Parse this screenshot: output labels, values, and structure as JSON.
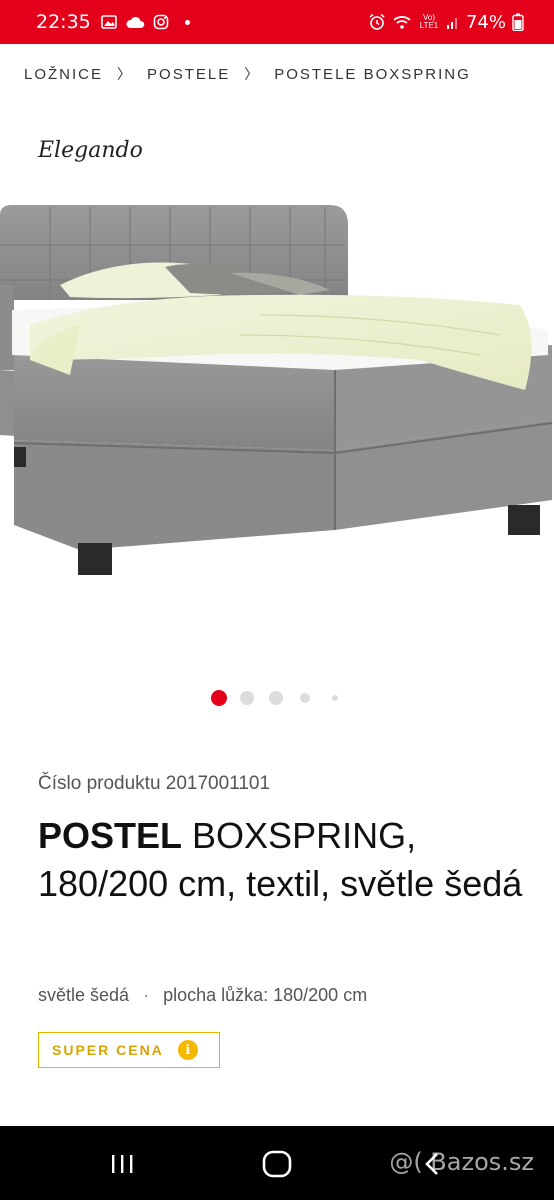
{
  "status_bar": {
    "time": "22:35",
    "battery": "74%",
    "network": "Vo) LTE1",
    "icons": [
      "gallery-icon",
      "cloud-icon",
      "instagram-icon",
      "notification-dot-icon",
      "alarm-icon",
      "wifi-icon",
      "signal-icon",
      "battery-icon"
    ]
  },
  "breadcrumb": {
    "items": [
      "LOŽNICE",
      "POSTELE",
      "POSTELE BOXSPRING"
    ]
  },
  "brand": {
    "name": "Elegando"
  },
  "carousel": {
    "count": 5,
    "active_index": 0
  },
  "product": {
    "number_label": "Číslo produktu 2017001101",
    "title_bold": "POSTEL",
    "title_rest": " BOXSPRING, 180/200 cm, textil, světle šedá",
    "meta_color": "světle šedá",
    "meta_separator": "·",
    "meta_size": "plocha lůžka: 180/200 cm",
    "badge_label": "SUPER CENA",
    "badge_info": "i"
  },
  "nav_bar": {
    "buttons": [
      "recent-apps-icon",
      "home-icon",
      "back-icon"
    ],
    "watermark": "@( Bazos.sz"
  },
  "colors": {
    "status_bar": "#e2001a",
    "active_dot": "#e2001a",
    "badge": "#f5b800"
  }
}
